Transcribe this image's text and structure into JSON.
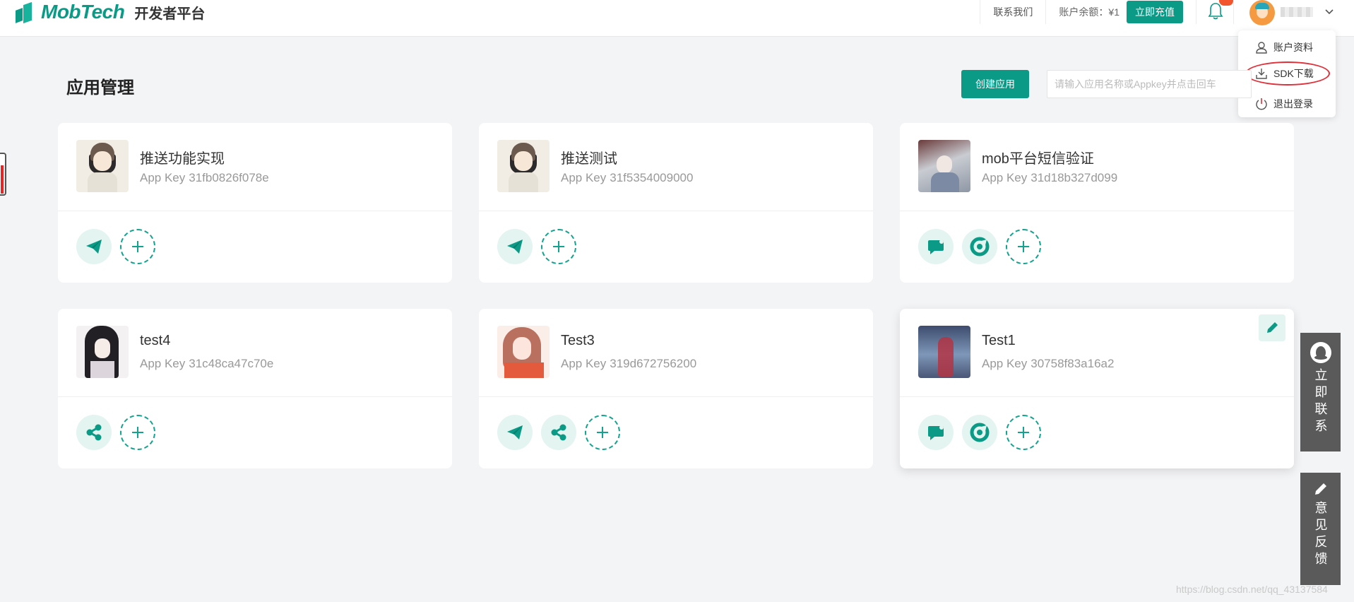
{
  "header": {
    "logo_text": "MobTech",
    "logo_sub": "开发者平台",
    "contact_link": "联系我们",
    "balance_label": "账户余额：¥1",
    "recharge_button": "立即充值"
  },
  "user_menu": {
    "items": [
      {
        "label": "账户资料",
        "icon": "user-icon"
      },
      {
        "label": "SDK下载",
        "icon": "download-icon"
      },
      {
        "label": "退出登录",
        "icon": "power-icon"
      }
    ]
  },
  "main": {
    "title": "应用管理",
    "create_button": "创建应用",
    "search_placeholder": "请输入应用名称或Appkey并点击回车"
  },
  "apps": [
    {
      "name": "推送功能实现",
      "key_label": "App Key",
      "key": "31fb0826f078e",
      "services": [
        "push-icon"
      ]
    },
    {
      "name": "推送测试",
      "key_label": "App Key",
      "key": "31f5354009000",
      "services": [
        "push-icon"
      ]
    },
    {
      "name": "mob平台短信验证",
      "key_label": "App Key",
      "key": "31d18b327d099",
      "services": [
        "sms-icon",
        "mobverify-icon"
      ]
    },
    {
      "name": "test4",
      "key_label": "App Key",
      "key": "31c48ca47c70e",
      "services": [
        "share-icon"
      ]
    },
    {
      "name": "Test3",
      "key_label": "App Key",
      "key": "319d672756200",
      "services": [
        "push-icon",
        "share-icon"
      ]
    },
    {
      "name": "Test1",
      "key_label": "App Key",
      "key": "30758f83a16a2",
      "services": [
        "sms-icon",
        "mobverify-icon"
      ]
    }
  ],
  "floating": {
    "contact_label": "立即联系",
    "feedback_label": "意见反馈"
  },
  "watermark": "https://blog.csdn.net/qq_43137584",
  "colors": {
    "accent": "#0a9a86",
    "service_bg": "#e3f4f1",
    "highlight_ring": "#e0303a",
    "badge": "#f2542d"
  }
}
